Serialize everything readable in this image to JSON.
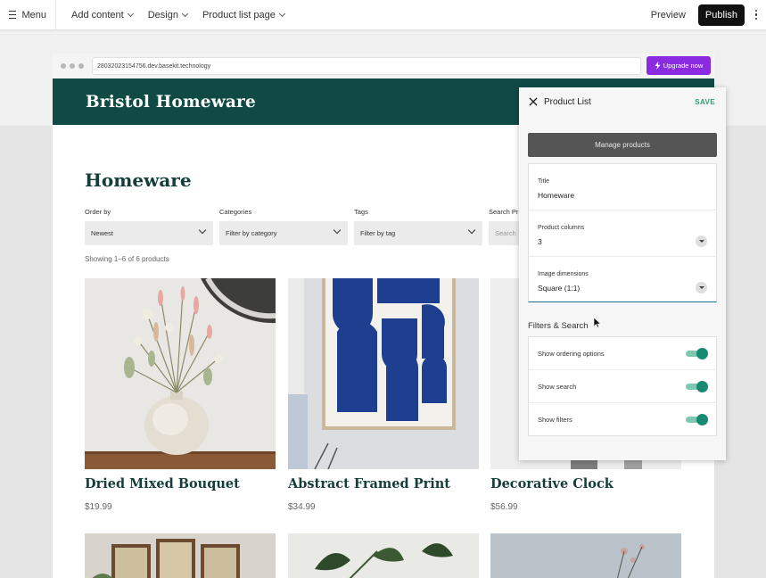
{
  "topbar": {
    "menu_label": "Menu",
    "add_content": "Add content",
    "design": "Design",
    "page_select": "Product list page",
    "preview": "Preview",
    "publish": "Publish"
  },
  "browser": {
    "url": "28032023154756.dev.basekit.technology",
    "upgrade_label": "Upgrade now"
  },
  "site": {
    "brand": "Bristol Homeware",
    "page_title": "Homeware",
    "filters": [
      {
        "label": "Order by",
        "value": "Newest"
      },
      {
        "label": "Categories",
        "value": "Filter by category"
      },
      {
        "label": "Tags",
        "value": "Filter by tag"
      },
      {
        "label": "Search Pr",
        "value": "Search"
      }
    ],
    "showing": "Showing 1–6 of 6 products",
    "products": [
      {
        "name": "Dried Mixed Bouquet",
        "price": "$19.99"
      },
      {
        "name": "Abstract Framed Print",
        "price": "$34.99"
      },
      {
        "name": "Decorative Clock",
        "price": "$56.99"
      }
    ]
  },
  "panel": {
    "title": "Product List",
    "save": "SAVE",
    "manage_button": "Manage products",
    "fields": [
      {
        "label": "Title",
        "value": "Homeware"
      },
      {
        "label": "Product columns",
        "value": "3"
      },
      {
        "label": "Image dimensions",
        "value": "Square (1:1)"
      }
    ],
    "section_title": "Filters & Search",
    "toggles": [
      {
        "label": "Show ordering options",
        "on": true
      },
      {
        "label": "Show search",
        "on": true
      },
      {
        "label": "Show filters",
        "on": true
      }
    ]
  },
  "colors": {
    "brand_green": "#0f4a44",
    "heading_green": "#153e3a",
    "accent_toggle": "#178a72",
    "save_green": "#2a9d6f",
    "upgrade_purple": "#8a2be2"
  }
}
